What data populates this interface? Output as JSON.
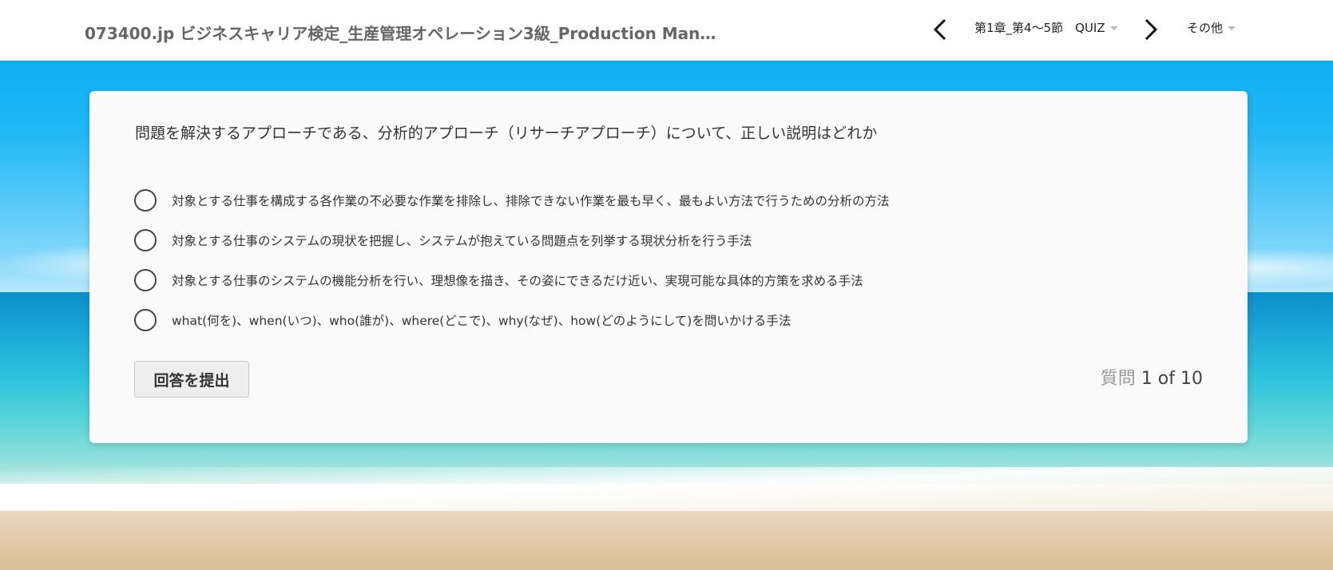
{
  "header": {
    "course_title": "073400.jp ビジネスキャリア検定_生産管理オペレーション3級_Production Managemen...",
    "section_select_label": "第1章_第4〜5節　QUIZ",
    "other_select_label": "その他",
    "icons": {
      "prev": "chevron-left-icon",
      "next": "chevron-right-icon",
      "dropdown": "caret-down-icon"
    }
  },
  "quiz": {
    "question": "問題を解決するアプローチである、分析的アプローチ（リサーチアプローチ）について、正しい説明はどれか",
    "options": [
      "対象とする仕事を構成する各作業の不必要な作業を排除し、排除できない作業を最も早く、最もよい方法で行うための分析の方法",
      "対象とする仕事のシステムの現状を把握し、システムが抱えている問題点を列挙する現状分析を行う手法",
      "対象とする仕事のシステムの機能分析を行い、理想像を描き、その姿にできるだけ近い、実現可能な具体的方策を求める手法",
      "what(何を)、when(いつ)、who(誰が)、where(どこで)、why(なぜ)、how(どのようにして)を問いかける手法"
    ],
    "submit_label": "回答を提出",
    "progress_prefix": "質問",
    "progress_count": "1 of 10"
  },
  "colors": {
    "header_bg": "#ffffff",
    "card_bg": "#fafafa",
    "title_text": "#666666",
    "body_text": "#333333",
    "progress_prefix": "#999999"
  }
}
